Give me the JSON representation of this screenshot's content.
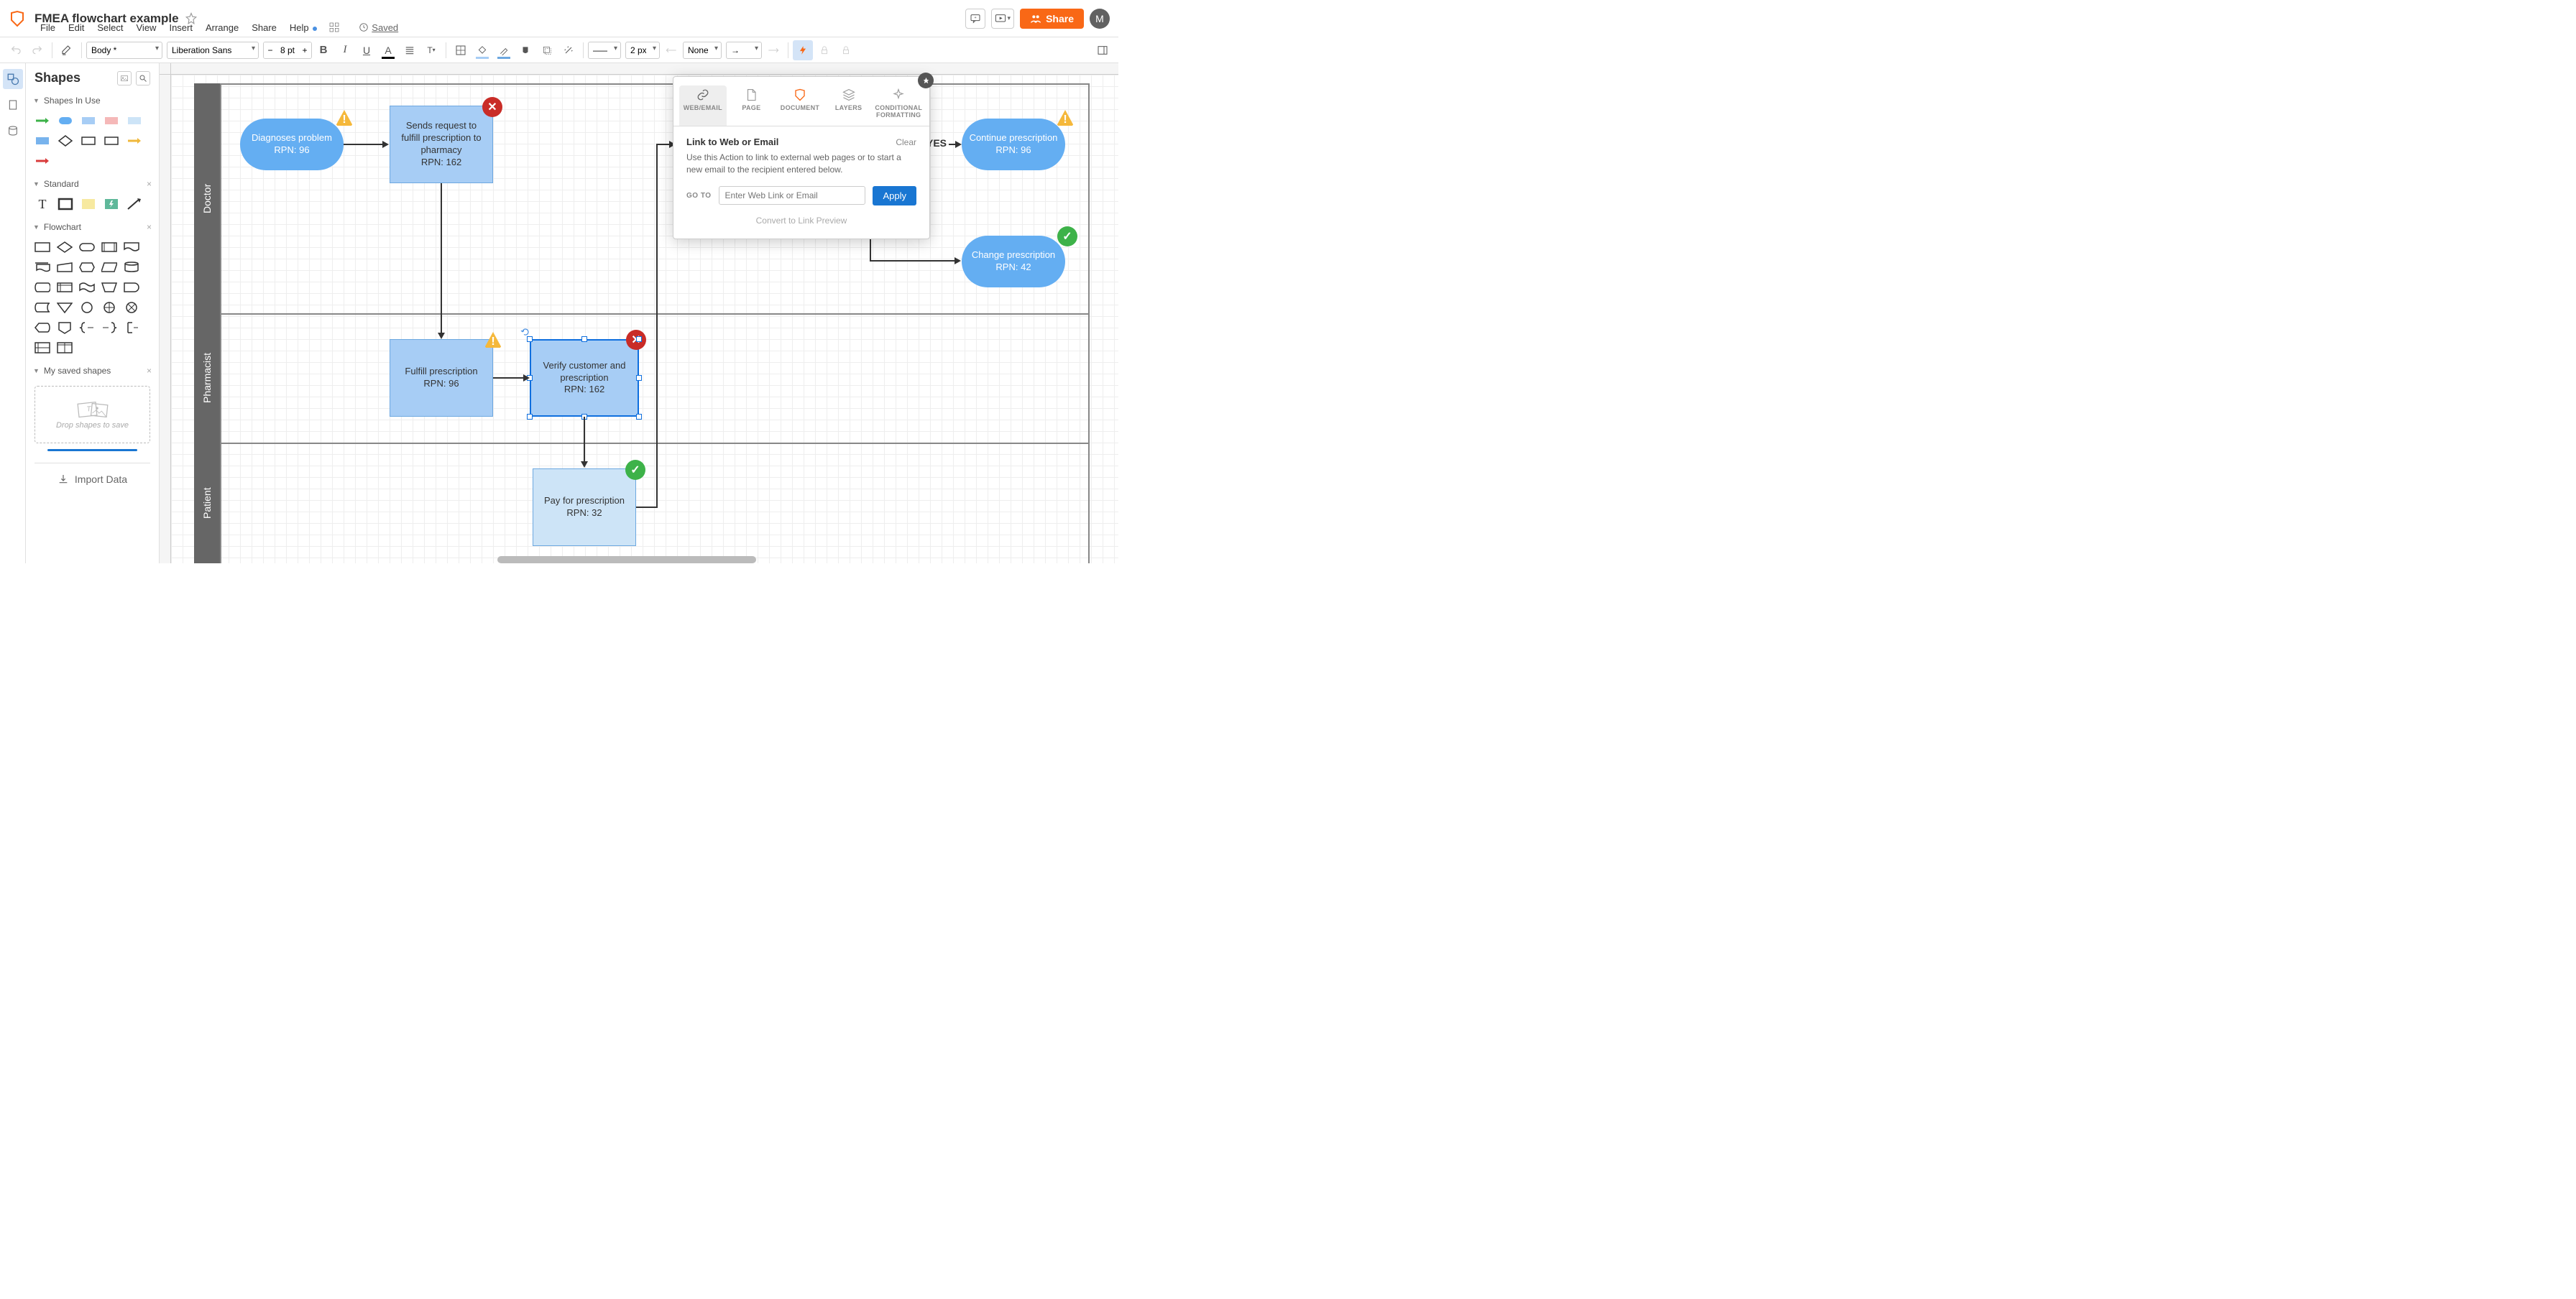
{
  "header": {
    "doc_title": "FMEA flowchart example",
    "share_label": "Share",
    "avatar_letter": "M"
  },
  "menu": {
    "file": "File",
    "edit": "Edit",
    "select": "Select",
    "view": "View",
    "insert": "Insert",
    "arrange": "Arrange",
    "share": "Share",
    "help": "Help",
    "saved": "Saved"
  },
  "toolbar": {
    "font_family": "Body *",
    "font_name": "Liberation Sans",
    "font_size": "8 pt",
    "line_style": "———",
    "line_width": "2 px",
    "end_none": "None"
  },
  "shapes_panel": {
    "title": "Shapes",
    "sections": {
      "in_use": "Shapes In Use",
      "standard": "Standard",
      "flowchart": "Flowchart",
      "saved": "My saved shapes"
    },
    "drop_hint": "Drop shapes to save",
    "import": "Import Data"
  },
  "swimlanes": {
    "doctor": "Doctor",
    "pharmacist": "Pharmacist",
    "patient": "Patient"
  },
  "nodes": {
    "diagnose": "Diagnoses problem\nRPN: 96",
    "sends_request": "Sends request to fulfill prescription to pharmacy\nRPN: 162",
    "continue": "Continue prescription\nRPN: 96",
    "change": "Change prescription\nRPN: 42",
    "fulfill": "Fulfill prescription\nRPN: 96",
    "verify": "Verify customer and prescription\nRPN: 162",
    "pay": "Pay for prescription\nRPN: 32",
    "yes": "YES"
  },
  "popup": {
    "tabs": {
      "web": "WEB/EMAIL",
      "page": "PAGE",
      "document": "DOCUMENT",
      "layers": "LAYERS",
      "conditional": "CONDITIONAL FORMATTING"
    },
    "title": "Link to Web or Email",
    "clear": "Clear",
    "desc": "Use this Action to link to external web pages or to start a new email to the recipient entered below.",
    "goto": "GO TO",
    "placeholder": "Enter Web Link or Email",
    "apply": "Apply",
    "convert": "Convert to Link Preview"
  }
}
